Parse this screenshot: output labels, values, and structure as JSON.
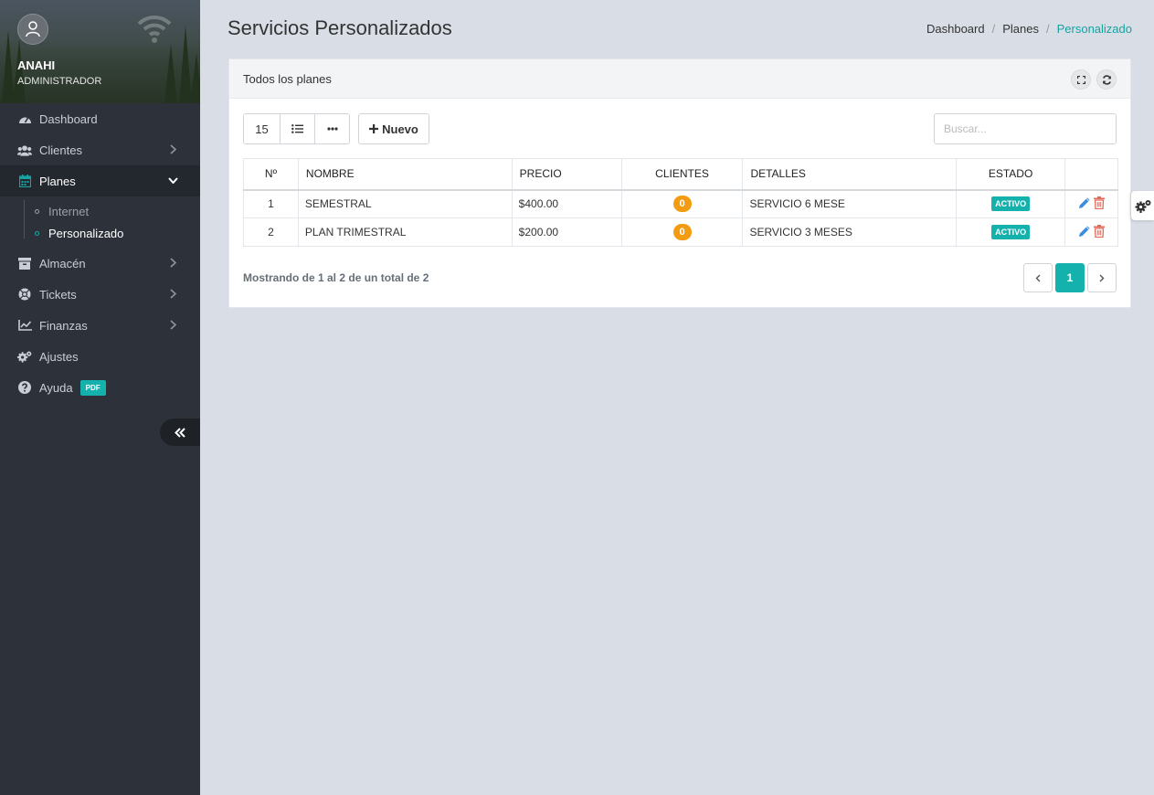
{
  "user": {
    "name": "ANAHI",
    "role": "ADMINISTRADOR"
  },
  "sidebar": {
    "items": [
      {
        "label": "Dashboard",
        "icon": "dashboard-icon"
      },
      {
        "label": "Clientes",
        "icon": "users-icon",
        "has_children": true
      },
      {
        "label": "Planes",
        "icon": "calendar-icon",
        "has_children": true,
        "expanded": true,
        "children": [
          {
            "label": "Internet"
          },
          {
            "label": "Personalizado",
            "current": true
          }
        ]
      },
      {
        "label": "Almacén",
        "icon": "archive-icon",
        "has_children": true
      },
      {
        "label": "Tickets",
        "icon": "lifebuoy-icon",
        "has_children": true
      },
      {
        "label": "Finanzas",
        "icon": "chart-line-icon",
        "has_children": true
      },
      {
        "label": "Ajustes",
        "icon": "cogs-icon"
      },
      {
        "label": "Ayuda",
        "icon": "question-circle-icon",
        "badge": "PDF"
      }
    ]
  },
  "page": {
    "title": "Servicios Personalizados",
    "breadcrumb": [
      "Dashboard",
      "Planes",
      "Personalizado"
    ]
  },
  "panel": {
    "title": "Todos los planes",
    "page_size": "15",
    "new_label": "Nuevo",
    "search_placeholder": "Buscar...",
    "columns": [
      "Nº",
      "NOMBRE",
      "PRECIO",
      "CLIENTES",
      "DETALLES",
      "ESTADO",
      ""
    ],
    "rows": [
      {
        "n": "1",
        "name": "SEMESTRAL",
        "price": "$400.00",
        "clients": "0",
        "details": "SERVICIO 6 MESE",
        "status": "ACTIVO"
      },
      {
        "n": "2",
        "name": "PLAN TRIMESTRAL",
        "price": "$200.00",
        "clients": "0",
        "details": "SERVICIO 3 MESES",
        "status": "ACTIVO"
      }
    ],
    "info": "Mostrando de 1 al 2 de un total de 2",
    "pagination": {
      "current": "1"
    }
  },
  "colors": {
    "accent": "#14b1ad",
    "sidebar": "#2d323a",
    "badge_orange": "#f39c12",
    "edit_blue": "#3c8dde",
    "delete_red": "#e06c5c"
  }
}
